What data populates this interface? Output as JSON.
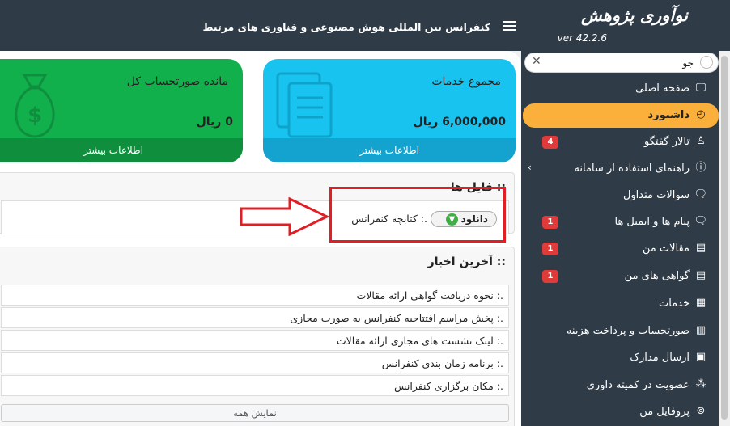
{
  "header": {
    "title": "کنفرانس بین المللی هوش مصنوعی و فناوری های مرتبط",
    "logo_text": "نوآوری پژوهش",
    "version": "ver 42.2.6"
  },
  "search": {
    "value": "جو",
    "placeholder": ""
  },
  "sidebar": {
    "items": [
      {
        "label": "صفحه اصلی",
        "icon": "monitor-icon",
        "badge": ""
      },
      {
        "label": "داشبورد",
        "icon": "dashboard-icon",
        "badge": "",
        "active": true
      },
      {
        "label": "تالار گفتگو",
        "icon": "user-icon",
        "badge": "4"
      },
      {
        "label": "راهنمای استفاده از سامانه",
        "icon": "info-icon",
        "badge": ""
      },
      {
        "label": "سوالات متداول",
        "icon": "chat-icon",
        "badge": ""
      },
      {
        "label": "پیام ها و ایمیل ها",
        "icon": "message-icon",
        "badge": "1"
      },
      {
        "label": "مقالات من",
        "icon": "document-icon",
        "badge": "1"
      },
      {
        "label": "گواهی های من",
        "icon": "certificate-icon",
        "badge": "1"
      },
      {
        "label": "خدمات",
        "icon": "services-icon",
        "badge": ""
      },
      {
        "label": "صورتحساب و پرداخت هزینه",
        "icon": "invoice-icon",
        "badge": ""
      },
      {
        "label": "ارسال مدارک",
        "icon": "upload-icon",
        "badge": ""
      },
      {
        "label": "عضویت در کمیته داوری",
        "icon": "committee-icon",
        "badge": ""
      },
      {
        "label": "پروفایل من",
        "icon": "profile-icon",
        "badge": ""
      }
    ]
  },
  "cards": {
    "services": {
      "title": "مجموع خدمات",
      "value": "6,000,000 ریال",
      "footer": "اطلاعات بیشتر",
      "color": "#18c3f0"
    },
    "balance": {
      "title": "مانده صورتحساب کل",
      "value": "0 ریال",
      "footer": "اطلاعات بیشتر",
      "color": "#12b04c"
    }
  },
  "files": {
    "title": ":: فایل ها",
    "download_label": "دانلود",
    "file_name": ".: کتابچه کنفرانس"
  },
  "news": {
    "title": ":: آخرین اخبار",
    "items": [
      ".: نحوه دریافت گواهی ارائه مقالات",
      ".: پخش مراسم افتتاحیه کنفرانس به صورت مجازی",
      ".: لینک نشست های مجازی ارائه مقالات",
      ".: برنامه زمان بندی کنفرانس",
      ".: مکان برگزاری کنفرانس"
    ],
    "show_all": "نمایش همه"
  },
  "colors": {
    "header_bg": "#2f3c48",
    "active_item": "#fbb03b",
    "badge": "#e03b3b",
    "highlight": "#e21d24"
  }
}
